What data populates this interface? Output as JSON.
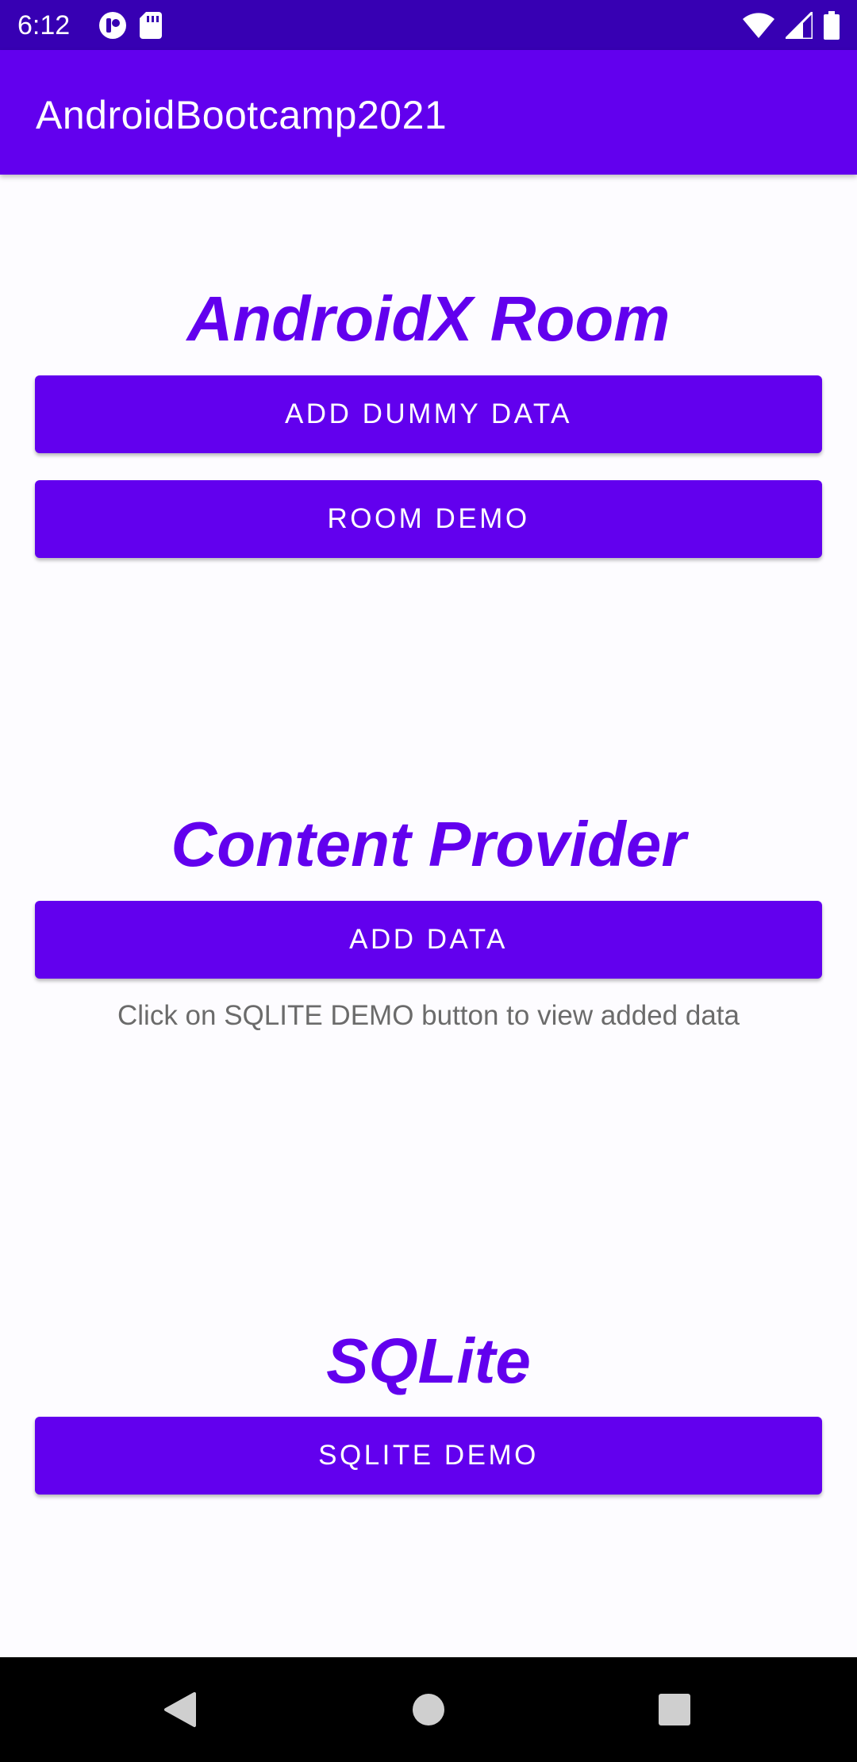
{
  "status_bar": {
    "time": "6:12",
    "background": "#3700b3",
    "left_icons": [
      "notification-icon",
      "sd-card-icon"
    ],
    "right_icons": [
      "wifi-icon",
      "signal-icon",
      "battery-icon"
    ]
  },
  "app_bar": {
    "title": "AndroidBootcamp2021",
    "background": "#6200ee"
  },
  "sections": {
    "room": {
      "title": "AndroidX Room",
      "add_dummy_data_label": "ADD DUMMY DATA",
      "room_demo_label": "ROOM DEMO"
    },
    "content_provider": {
      "title": "Content Provider",
      "add_data_label": "ADD DATA",
      "hint": "Click on SQLITE DEMO button to view added data"
    },
    "sqlite": {
      "title": "SQLite",
      "sqlite_demo_label": "SQLITE DEMO"
    }
  },
  "colors": {
    "accent": "#6200ee",
    "hint_text": "#6b6b6b",
    "background": "#fdfcff"
  },
  "nav_bar": {
    "icons": [
      "back-icon",
      "home-icon",
      "recents-icon"
    ]
  }
}
